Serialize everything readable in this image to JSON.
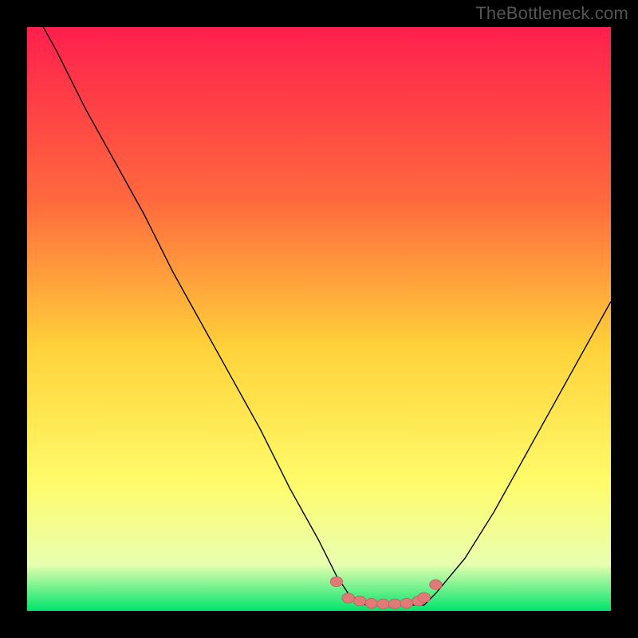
{
  "watermark": "TheBottleneck.com",
  "colors": {
    "bg": "#000000",
    "grad_top": "#ff1f4d",
    "grad_mid1": "#ff6a3d",
    "grad_mid2": "#ffd23a",
    "grad_mid3": "#fffb6a",
    "grad_mid4": "#e9ffb0",
    "grad_bottom": "#00e46c",
    "curve": "#000000",
    "dot_fill": "#e07a78",
    "dot_stroke": "#c46260"
  },
  "chart_data": {
    "type": "line",
    "title": "",
    "xlabel": "",
    "ylabel": "",
    "xlim": [
      0,
      100
    ],
    "ylim": [
      0,
      100
    ],
    "series": [
      {
        "name": "bottleneck-curve",
        "x": [
          0,
          5,
          10,
          15,
          20,
          25,
          30,
          35,
          40,
          45,
          50,
          53,
          55,
          58,
          60,
          63,
          65,
          68,
          70,
          75,
          80,
          85,
          90,
          95,
          100
        ],
        "y": [
          105,
          96,
          86,
          77,
          68,
          58,
          49,
          40,
          31,
          21,
          12,
          6,
          3,
          1,
          1,
          1,
          1,
          1,
          3,
          9,
          17,
          26,
          35,
          44,
          53
        ]
      }
    ],
    "dots": {
      "name": "optimal-range",
      "x": [
        53,
        55,
        57,
        59,
        61,
        63,
        65,
        67,
        68,
        70
      ],
      "y": [
        5,
        2.2,
        1.7,
        1.3,
        1.2,
        1.2,
        1.3,
        1.7,
        2.3,
        4.5
      ]
    }
  }
}
